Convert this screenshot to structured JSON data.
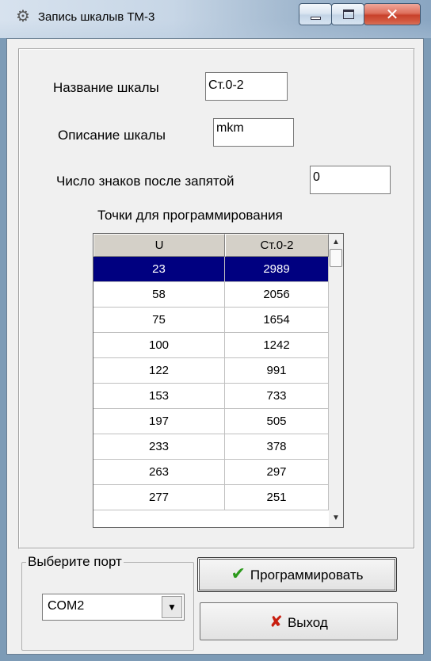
{
  "window": {
    "title": "Запись шкалыв ТМ-3",
    "icon": "gear-icon",
    "controls": {
      "minimize": "minimize-icon",
      "maximize": "maximize-icon",
      "close": "close-icon"
    }
  },
  "form": {
    "scale_name_label": "Название шкалы",
    "scale_name_value": "Ст.0-2",
    "scale_desc_label": "Описание шкалы",
    "scale_desc_value": "mkm",
    "decimals_label": "Число знаков после запятой",
    "decimals_value": "0",
    "points_title": "Точки для программирования"
  },
  "grid": {
    "columns": [
      "U",
      "Ст.0-2"
    ],
    "rows": [
      [
        "23",
        "2989"
      ],
      [
        "58",
        "2056"
      ],
      [
        "75",
        "1654"
      ],
      [
        "100",
        "1242"
      ],
      [
        "122",
        "991"
      ],
      [
        "153",
        "733"
      ],
      [
        "197",
        "505"
      ],
      [
        "233",
        "378"
      ],
      [
        "263",
        "297"
      ],
      [
        "277",
        "251"
      ]
    ],
    "selected_row": 0
  },
  "port": {
    "group_label": "Выберите порт",
    "selected": "COM2"
  },
  "buttons": {
    "program_label": "Программировать",
    "program_icon": "check-icon",
    "exit_label": "Выход",
    "exit_icon": "x-icon"
  },
  "colors": {
    "selection": "#000080",
    "check": "#2c9a1c",
    "exit_x": "#c81e0f"
  }
}
